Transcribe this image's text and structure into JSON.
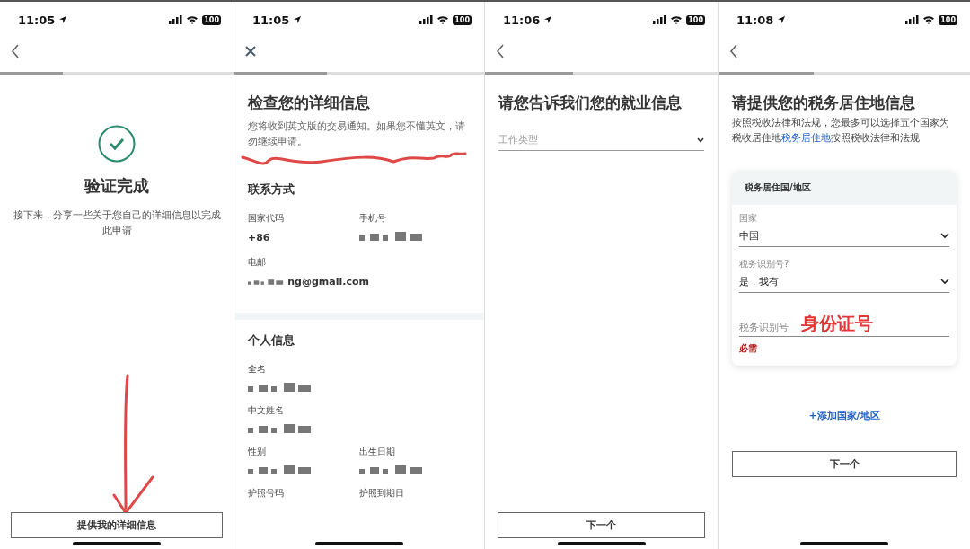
{
  "screens": [
    {
      "kind": "verification",
      "status_bar": {
        "time": "11:05",
        "battery": "100"
      },
      "nav": {
        "kind": "back"
      },
      "progress": {
        "level": 0.27
      },
      "title": "验证完成",
      "message": "接下来，分享一些关于您自己的详细信息以完成此申请",
      "annotation": {
        "kind": "arrow"
      },
      "button": "提供我的详细信息"
    },
    {
      "kind": "review",
      "status_bar": {
        "time": "11:05",
        "battery": "100"
      },
      "nav": {
        "kind": "close"
      },
      "progress": {
        "level": 0.37
      },
      "title": "检查您的详细信息",
      "notice": "您将收到英文版的交易通知。如果您不懂英文，请勿继续申请。",
      "annotation": {
        "kind": "squiggle"
      },
      "sections": [
        {
          "title": "联系方式",
          "rows": [
            {
              "fields": [
                {
                  "label": "国家代码",
                  "value": "+86",
                  "redacted": false
                },
                {
                  "label": "手机号",
                  "redacted": true
                }
              ]
            },
            {
              "fields": [
                {
                  "label": "电邮",
                  "value": "ng@gmail.com",
                  "redacted": true
                }
              ]
            }
          ]
        },
        {
          "title": "个人信息",
          "rows": [
            {
              "fields": [
                {
                  "label": "全名",
                  "redacted": true
                }
              ]
            },
            {
              "fields": [
                {
                  "label": "中文姓名",
                  "redacted": true
                }
              ]
            },
            {
              "fields": [
                {
                  "label": "性别",
                  "redacted": true
                },
                {
                  "label": "出生日期",
                  "redacted": true
                }
              ]
            },
            {
              "fields": [
                {
                  "label": "护照号码",
                  "redacted": false
                },
                {
                  "label": "护照到期日",
                  "redacted": false
                }
              ]
            }
          ]
        }
      ]
    },
    {
      "kind": "employment",
      "status_bar": {
        "time": "11:06",
        "battery": "100"
      },
      "nav": {
        "kind": "back"
      },
      "progress": {
        "level": 0.38
      },
      "title": "请您告诉我们您的就业信息",
      "select": {
        "placeholder": "工作类型"
      },
      "button": "下一个"
    },
    {
      "kind": "tax",
      "status_bar": {
        "time": "11:08",
        "battery": "100"
      },
      "nav": {
        "kind": "back"
      },
      "progress": {
        "level": 0.38
      },
      "title": "请提供您的税务居住地信息",
      "description": {
        "before": "按照税收法律和法规，您最多可以选择五个国家为税收居住地",
        "link": "税务居住地",
        "after": "按照税收法律和法规"
      },
      "card": {
        "title": "税务居住国/地区",
        "fields": [
          {
            "kind": "select",
            "label": "国家",
            "value": "中国"
          },
          {
            "kind": "select",
            "label": "税务识别号?",
            "value": "是，我有"
          },
          {
            "kind": "input",
            "placeholder": "税务识别号",
            "handwritten": "身份证号",
            "error": "必需"
          }
        ]
      },
      "add_link": "+添加国家/地区",
      "button": "下一个"
    }
  ]
}
